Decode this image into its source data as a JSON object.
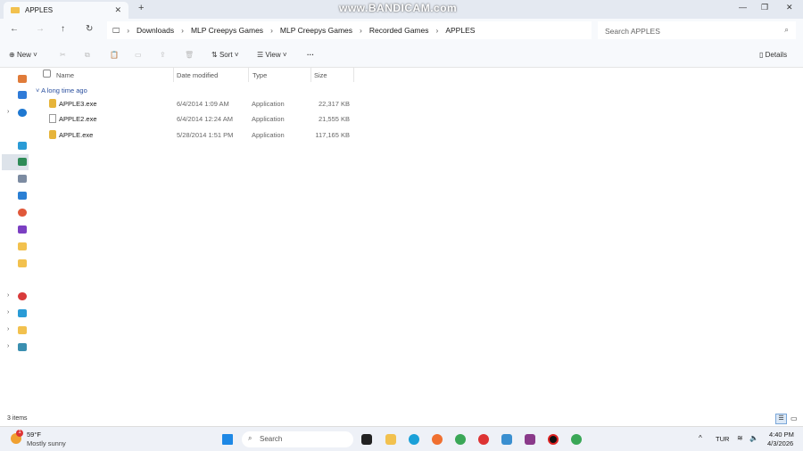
{
  "window": {
    "tab_title": "APPLES",
    "watermark": "www.BANDICAM.com"
  },
  "nav": {
    "breadcrumbs": [
      "Downloads",
      "MLP Creepys Games",
      "MLP Creepys Games",
      "Recorded Games",
      "APPLES"
    ],
    "search_placeholder": "Search APPLES"
  },
  "toolbar": {
    "new": "New",
    "sort": "Sort",
    "view": "View",
    "more": "···",
    "details": "Details"
  },
  "columns": {
    "name": "Name",
    "date": "Date modified",
    "type": "Type",
    "size": "Size"
  },
  "group": "A long time ago",
  "files": [
    {
      "name": "APPLE3.exe",
      "date": "6/4/2014 1:09 AM",
      "type": "Application",
      "size": "22,317 KB",
      "icon": "app-icon"
    },
    {
      "name": "APPLE2.exe",
      "date": "6/4/2014 12:24 AM",
      "type": "Application",
      "size": "21,555 KB",
      "icon": "file-icon"
    },
    {
      "name": "APPLE.exe",
      "date": "5/28/2014 1:51 PM",
      "type": "Application",
      "size": "117,165 KB",
      "icon": "app-icon"
    }
  ],
  "status": "3 items",
  "taskbar": {
    "temp": "59°F",
    "weather": "Mostly sunny",
    "search": "Search",
    "lang": "TUR",
    "time": "4:40 PM",
    "date": "4/3/2026",
    "weather_badge": "1"
  }
}
